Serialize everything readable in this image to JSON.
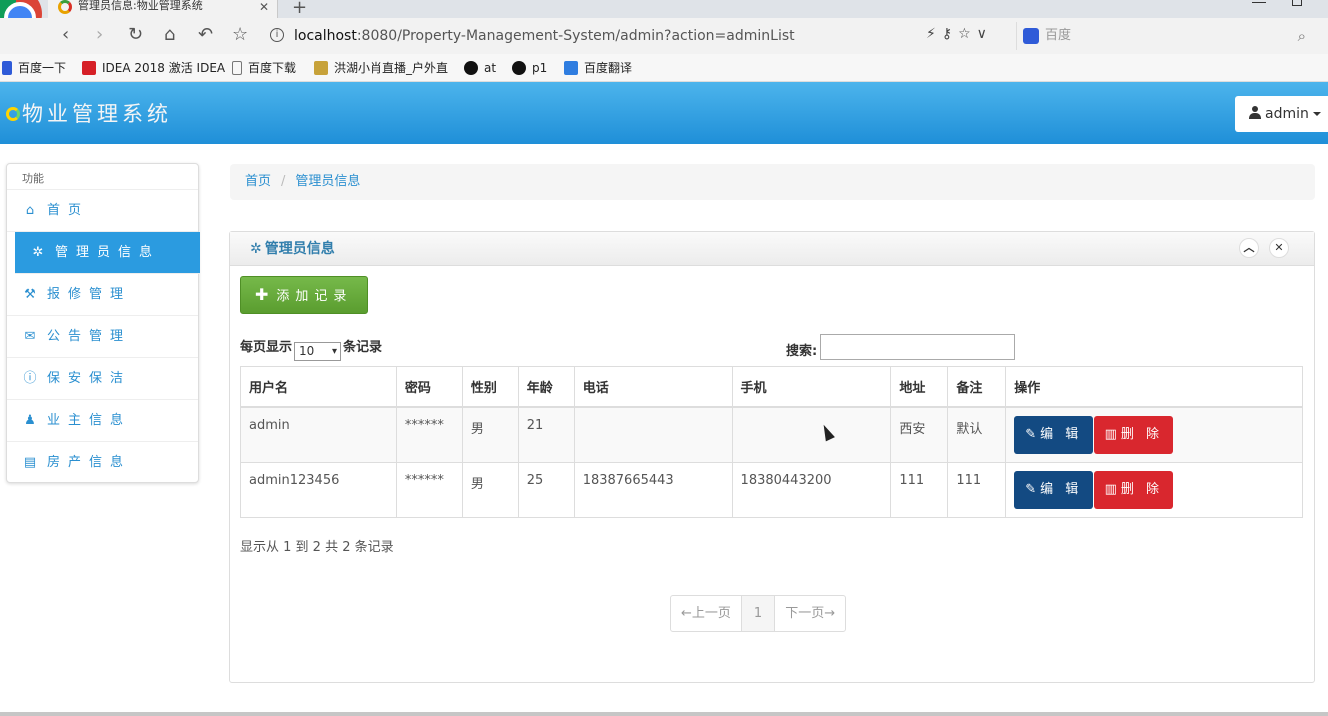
{
  "browser": {
    "tab_title": "管理员信息:物业管理系统",
    "url_host": "localhost",
    "url_rest": ":8080/Property-Management-System/admin?action=adminList",
    "search_placeholder": "百度",
    "bookmarks": [
      "百度一下",
      "IDEA 2018 激活 IDEA",
      "百度下载",
      "洪湖小肖直播_户外直",
      "at",
      "p1",
      "百度翻译"
    ]
  },
  "header": {
    "title": "物业管理系统",
    "user_label": "admin"
  },
  "sidebar": {
    "heading": "功能",
    "items": [
      {
        "label": "首页",
        "icon": "home-icon"
      },
      {
        "label": "管理员信息",
        "icon": "gear-icon"
      },
      {
        "label": "报修管理",
        "icon": "wrench-icon"
      },
      {
        "label": "公告管理",
        "icon": "envelope-icon"
      },
      {
        "label": "保安保洁",
        "icon": "info-icon"
      },
      {
        "label": "业主信息",
        "icon": "user-icon"
      },
      {
        "label": "房产信息",
        "icon": "list-icon"
      }
    ]
  },
  "breadcrumb": [
    "首页",
    "管理员信息"
  ],
  "panel": {
    "title": "管理员信息",
    "add_label": "添加记录",
    "length_prefix": "每页显示",
    "length_value": "10",
    "length_suffix": "条记录",
    "search_label": "搜索:",
    "info": "显示从 1 到 2 共 2 条记录",
    "pager": {
      "prev": "←上一页",
      "current": "1",
      "next": "下一页→"
    }
  },
  "table": {
    "columns": [
      "用户名",
      "密码",
      "性别",
      "年龄",
      "电话",
      "手机",
      "地址",
      "备注",
      "操作"
    ],
    "edit_label": "编 辑",
    "delete_label": "删 除",
    "rows": [
      {
        "username": "admin",
        "password": "******",
        "gender": "男",
        "age": "21",
        "phone": "",
        "mobile": "",
        "address": "西安",
        "remark": "默认"
      },
      {
        "username": "admin123456",
        "password": "******",
        "gender": "男",
        "age": "25",
        "phone": "18387665443",
        "mobile": "18380443200",
        "address": "111",
        "remark": "111"
      }
    ]
  }
}
